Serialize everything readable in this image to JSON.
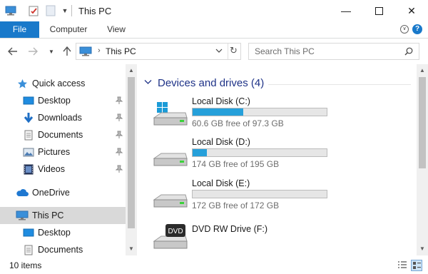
{
  "window": {
    "title": "This PC",
    "minimize_glyph": "—",
    "maximize_glyph": "☐",
    "close_glyph": "✕"
  },
  "ribbon": {
    "tabs": [
      {
        "label": "File",
        "active": true
      },
      {
        "label": "Computer",
        "active": false
      },
      {
        "label": "View",
        "active": false
      }
    ],
    "expand_icon": "chevron-down-icon",
    "help_label": "?"
  },
  "address": {
    "path": "This PC",
    "separator": "›"
  },
  "search": {
    "placeholder": "Search This PC"
  },
  "nav_pane": {
    "items": [
      {
        "label": "Quick access",
        "icon": "star-icon",
        "pinned": false
      },
      {
        "label": "Desktop",
        "icon": "desktop-icon",
        "pinned": true
      },
      {
        "label": "Downloads",
        "icon": "download-icon",
        "pinned": true
      },
      {
        "label": "Documents",
        "icon": "document-icon",
        "pinned": true
      },
      {
        "label": "Pictures",
        "icon": "picture-icon",
        "pinned": true
      },
      {
        "label": "Videos",
        "icon": "video-icon",
        "pinned": true
      },
      {
        "label": "OneDrive",
        "icon": "cloud-icon",
        "pinned": false
      },
      {
        "label": "This PC",
        "icon": "computer-icon",
        "pinned": false,
        "selected": true
      },
      {
        "label": "Desktop",
        "icon": "desktop-icon",
        "pinned": false
      },
      {
        "label": "Documents",
        "icon": "document-icon",
        "pinned": false
      }
    ]
  },
  "content": {
    "group_title": "Devices and drives (4)",
    "drives": [
      {
        "name": "Local Disk (C:)",
        "free": "60.6 GB free of 97.3 GB",
        "used_fraction": 0.377,
        "icon": "windows-drive-icon"
      },
      {
        "name": "Local Disk (D:)",
        "free": "174 GB free of 195 GB",
        "used_fraction": 0.108,
        "icon": "hard-drive-icon"
      },
      {
        "name": "Local Disk (E:)",
        "free": "172 GB free of 172 GB",
        "used_fraction": 0.0,
        "icon": "hard-drive-icon"
      },
      {
        "name": "DVD RW Drive (F:)",
        "free": "",
        "used_fraction": null,
        "icon": "dvd-drive-icon"
      }
    ],
    "dvd_label": "DVD"
  },
  "status": {
    "item_count": "10 items"
  },
  "colors": {
    "accent": "#1979ca",
    "drive_bar": "#26a0da",
    "group_title": "#1e3287",
    "selected_bg": "#d9d9d9"
  }
}
